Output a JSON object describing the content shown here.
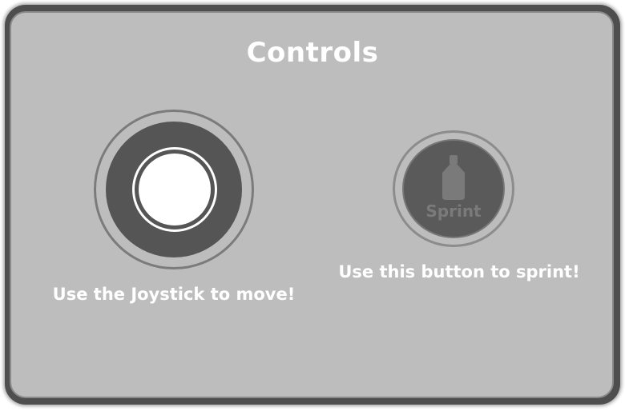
{
  "dialog": {
    "title": "Controls"
  },
  "joystick": {
    "label": "Use the Joystick to move!",
    "icon": "joystick-icon"
  },
  "sprint": {
    "button_text": "Sprint",
    "label": "Use this button to sprint!",
    "icon": "sprint-figure-icon"
  },
  "colors": {
    "panel": "#bdbdbd",
    "panel_border": "#4e4e4e",
    "joystick_base": "#555555",
    "joystick_knob": "#ffffff",
    "sprint_button": "#5a5a5a",
    "sprint_text": "#7a7a7a",
    "label_text": "#ffffff"
  }
}
